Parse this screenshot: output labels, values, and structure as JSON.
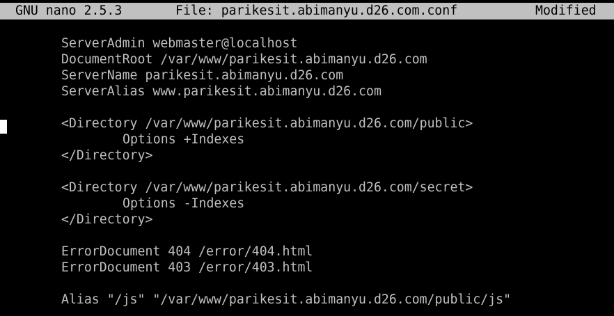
{
  "titlebar": {
    "app_version": "GNU nano 2.5.3",
    "file_label": "File: parikesit.abimanyu.d26.com.conf",
    "status": "Modified"
  },
  "editor": {
    "lines": [
      "ServerAdmin webmaster@localhost",
      "DocumentRoot /var/www/parikesit.abimanyu.d26.com",
      "ServerName parikesit.abimanyu.d26.com",
      "ServerAlias www.parikesit.abimanyu.d26.com",
      "",
      "<Directory /var/www/parikesit.abimanyu.d26.com/public>",
      "Options +Indexes",
      "</Directory>",
      "",
      "<Directory /var/www/parikesit.abimanyu.d26.com/secret>",
      "Options -Indexes",
      "</Directory>",
      "",
      "ErrorDocument 404 /error/404.html",
      "ErrorDocument 403 /error/403.html",
      "",
      "Alias \"/js\" \"/var/www/parikesit.abimanyu.d26.com/public/js\""
    ]
  }
}
